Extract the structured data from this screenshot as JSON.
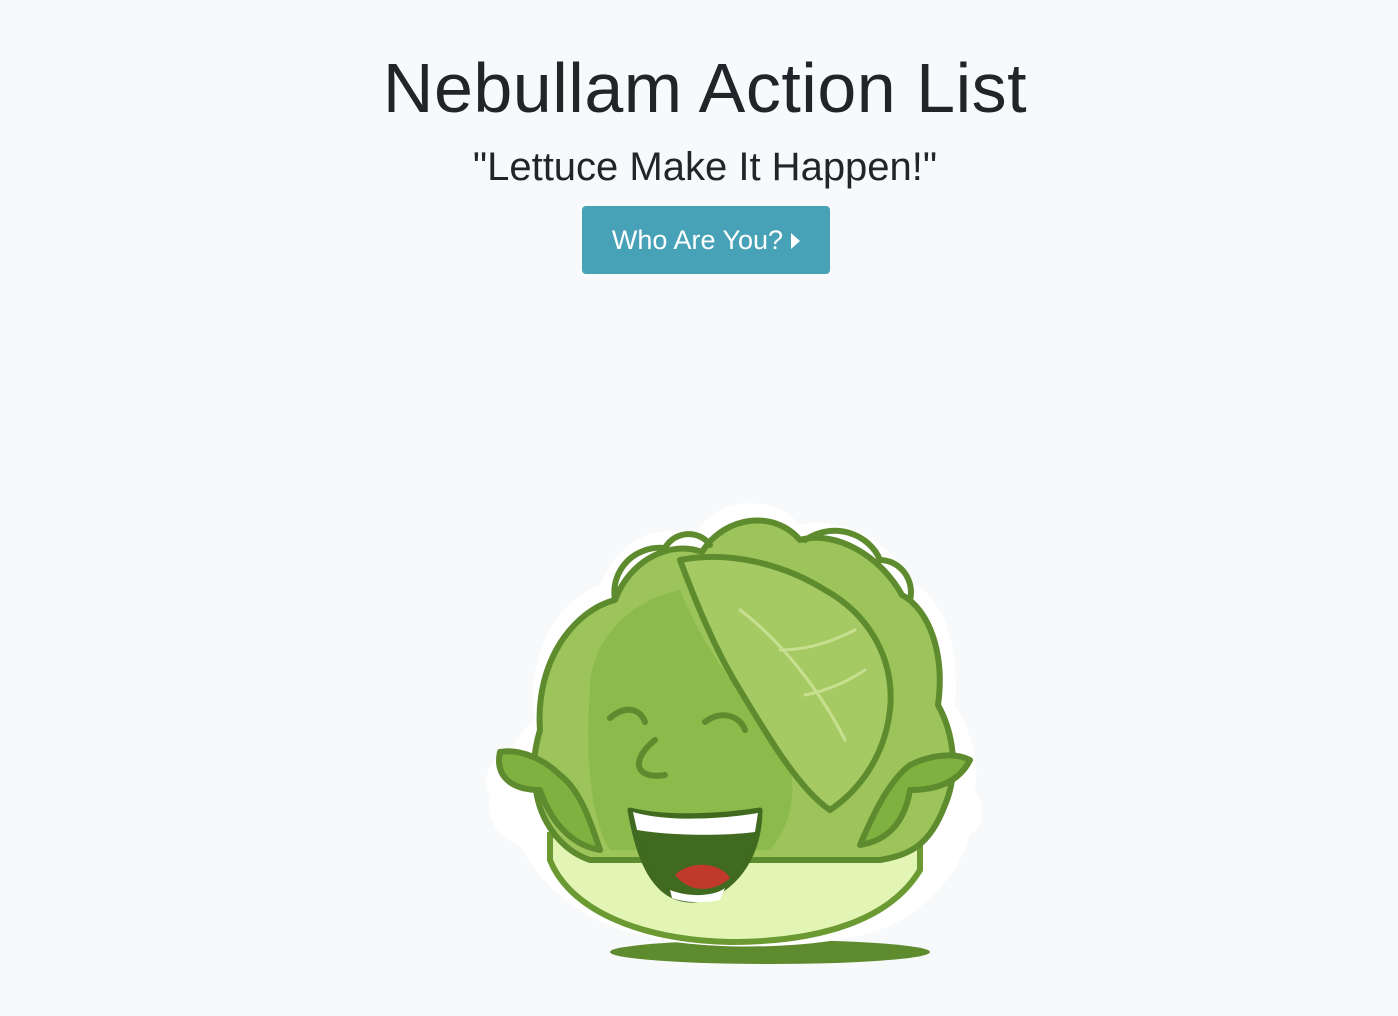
{
  "header": {
    "title": "Nebullam Action List",
    "tagline": "\"Lettuce Make It Happen!\""
  },
  "cta": {
    "label": "Who Are You?",
    "icon": "caret-right-icon"
  },
  "mascot": {
    "icon": "lettuce-mascot-illustration"
  },
  "colors": {
    "background": "#f8f9fa",
    "button": "#47a1b7",
    "text": "#212529",
    "lettuce_light": "#9cc45a",
    "lettuce_dark": "#5e8b2e",
    "lettuce_base": "#e3f5b4"
  }
}
